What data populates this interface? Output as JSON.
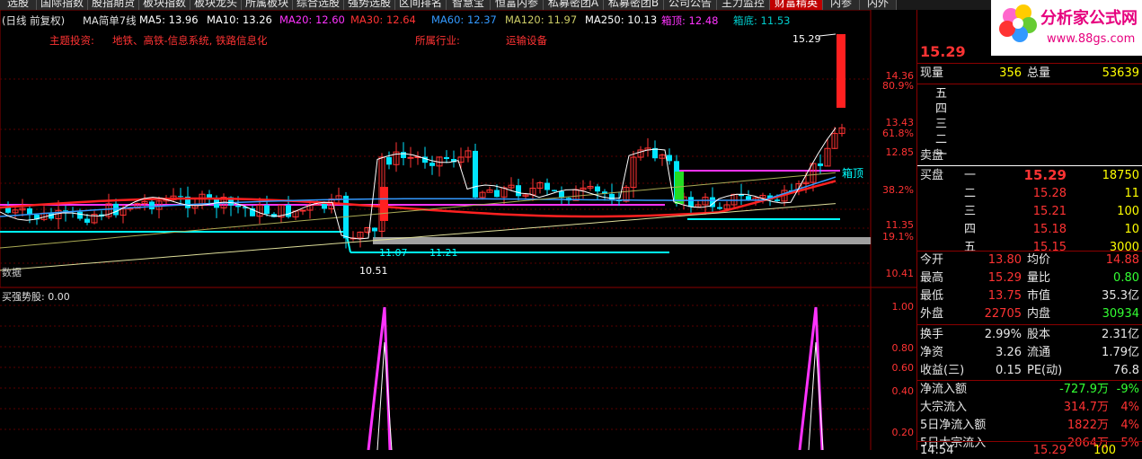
{
  "menu": [
    "选股",
    "国际指数",
    "股指期货",
    "板块指数",
    "板块龙头",
    "所属板块",
    "综合选股",
    "强势选股",
    "区间排名",
    "智慧宝",
    "恒富内参",
    "私募密团A",
    "私募密团B",
    "公司公告",
    "主力监控",
    "财富精英",
    "内参",
    "内外"
  ],
  "ma_line": [
    {
      "text": "(日线 前复权)",
      "color": "#e0e0e0"
    },
    {
      "text": "MA简单7线",
      "color": "#e0e0e0"
    },
    {
      "text": "MA5: 13.96",
      "color": "#ffffff"
    },
    {
      "text": "MA10: 13.26",
      "color": "#ffffff"
    },
    {
      "text": "MA20: 12.60",
      "color": "#ff33ff"
    },
    {
      "text": "MA30: 12.64",
      "color": "#ff3333"
    },
    {
      "text": "MA60: 12.37",
      "color": "#3399ff"
    },
    {
      "text": "MA120: 11.97",
      "color": "#cccc66"
    },
    {
      "text": "MA250: 10.13",
      "color": "#ffffff"
    },
    {
      "text": "箱顶: 12.48",
      "color": "#ff33ff"
    },
    {
      "text": "箱底: 11.53",
      "color": "#00cccc"
    }
  ],
  "info": {
    "theme_label": "主题投资:",
    "theme_value": "地铁、高铁-信息系统, 铁路信息化",
    "industry_label": "所属行业:",
    "industry_value": "运输设备"
  },
  "price_axis": [
    "14.36",
    "80.9%",
    "13.43",
    "61.8%",
    "12.85",
    "38.2%",
    "11.35",
    "19.1%",
    "10.41"
  ],
  "annotations": {
    "high": "15.29",
    "low": "10.51",
    "l1": "11.07",
    "l2": "11.21",
    "box_top": "箱顶",
    "left_label": "数据"
  },
  "indicator": {
    "title": "买强势股: 0.00",
    "axis": [
      "1.00",
      "0.80",
      "0.60",
      "0.40",
      "0.20"
    ]
  },
  "panel": {
    "header_price": "15.29",
    "rows1": [
      {
        "label": "现量",
        "v1": "356",
        "v1c": "#ffff00",
        "label2": "总量",
        "v2": "53639",
        "v2c": "#ffff00"
      }
    ],
    "sell_labels": [
      "五",
      "四",
      "三",
      "二",
      "一"
    ],
    "sell_title": "卖盘",
    "buy_title": "买盘",
    "buy": [
      {
        "label": "一",
        "price": "15.29",
        "vol": "18750"
      },
      {
        "label": "二",
        "price": "15.28",
        "vol": "11"
      },
      {
        "label": "三",
        "price": "15.21",
        "vol": "100"
      },
      {
        "label": "四",
        "price": "15.18",
        "vol": "10"
      },
      {
        "label": "五",
        "price": "15.15",
        "vol": "3000"
      }
    ],
    "stats": [
      {
        "l": "今开",
        "v": "13.80",
        "vc": "#ff3333",
        "l2": "均价",
        "v2": "14.88",
        "v2c": "#ff3333"
      },
      {
        "l": "最高",
        "v": "15.29",
        "vc": "#ff3333",
        "l2": "量比",
        "v2": "0.80",
        "v2c": "#33ff33"
      },
      {
        "l": "最低",
        "v": "13.75",
        "vc": "#ff3333",
        "l2": "市值",
        "v2": "35.3亿",
        "v2c": "#e6e6e6"
      },
      {
        "l": "外盘",
        "v": "22705",
        "vc": "#ff3333",
        "l2": "内盘",
        "v2": "30934",
        "v2c": "#33ff33"
      },
      {
        "l": "换手",
        "v": "2.99%",
        "vc": "#e6e6e6",
        "l2": "股本",
        "v2": "2.31亿",
        "v2c": "#e6e6e6"
      },
      {
        "l": "净资",
        "v": "3.26",
        "vc": "#e6e6e6",
        "l2": "流通",
        "v2": "1.79亿",
        "v2c": "#e6e6e6"
      },
      {
        "l": "收益(三)",
        "v": "0.15",
        "vc": "#e6e6e6",
        "l2": "PE(动)",
        "v2": "76.8",
        "v2c": "#e6e6e6"
      }
    ],
    "flow": [
      {
        "l": "净流入额",
        "v": "-727.9万",
        "vc": "#33ff33",
        "p": "-9%",
        "pc": "#33ff33"
      },
      {
        "l": "大宗流入",
        "v": "314.7万",
        "vc": "#ff3333",
        "p": "4%",
        "pc": "#ff3333"
      },
      {
        "l": "5日净流入额",
        "v": "1822万",
        "vc": "#ff3333",
        "p": "4%",
        "pc": "#ff3333"
      },
      {
        "l": "5日大宗流入",
        "v": "2064万",
        "vc": "#ff3333",
        "p": "5%",
        "pc": "#ff3333"
      }
    ],
    "last_time": "14:54",
    "last_price": "15.29",
    "last_vol": "100"
  },
  "logo": {
    "title": "分析家公式网",
    "url": "www.88gs.com"
  }
}
